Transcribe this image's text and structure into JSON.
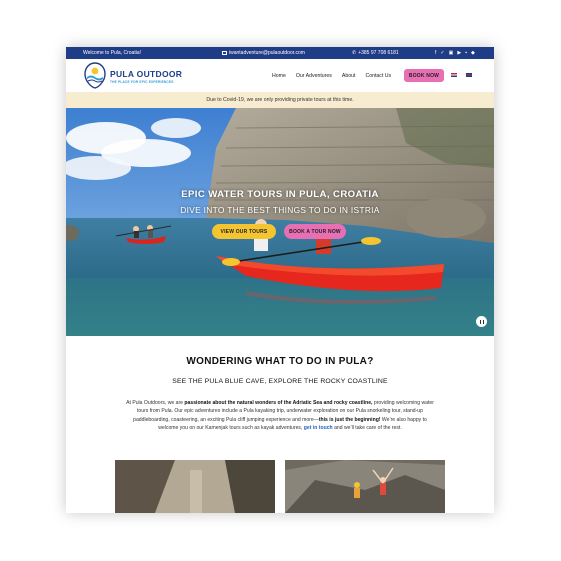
{
  "topbar": {
    "welcome": "Welcome to Pula, Croatia!",
    "email": "iwantadventure@pulaoutdoor.com",
    "phone": "+385 97 708 6181",
    "socials": [
      "f",
      "✓",
      "▣",
      "▶",
      "▪",
      "◆"
    ]
  },
  "header": {
    "brand_name": "PULA OUTDOOR",
    "brand_tagline": "THE PLACE FOR EPIC EXPERIENCES",
    "nav": [
      "Home",
      "Our Adventures",
      "About",
      "Contact Us"
    ],
    "book_now": "BOOK NOW"
  },
  "notice": "Due to Covid-19, we are only providing private tours at this time.",
  "hero": {
    "title": "EPIC WATER TOURS IN PULA, CROATIA",
    "subtitle": "DIVE INTO THE BEST THINGS TO DO IN ISTRIA",
    "btn_tours": "VIEW OUR TOURS",
    "btn_book": "BOOK A TOUR NOW"
  },
  "section": {
    "title": "WONDERING WHAT TO DO IN PULA?",
    "subtitle": "SEE THE PULA BLUE CAVE, EXPLORE THE ROCKY COASTLINE",
    "p1": "At Pula Outdoors, we are ",
    "p1_bold": "passionate about the natural wonders of the Adriatic Sea and rocky coastline,",
    "p2": " providing welcoming water tours from Pula. Our epic adventures include a Pula kayaking trip, underwater exploration on our Pula snorkeling tour, stand-up paddleboarding, coasteering, an exciting Pula cliff jumping experience and more—",
    "p2_bold": "this is just the beginning!",
    "p3": " We’re also happy to welcome you on our Kamenjak tours such as kayak adventures, ",
    "link": "get in touch",
    "p4": " and we’ll take care of the rest."
  },
  "colors": {
    "navy": "#1f3d86",
    "pink": "#e96fb5",
    "yellow": "#f5c531",
    "notice_bg": "#f8ecd0"
  }
}
